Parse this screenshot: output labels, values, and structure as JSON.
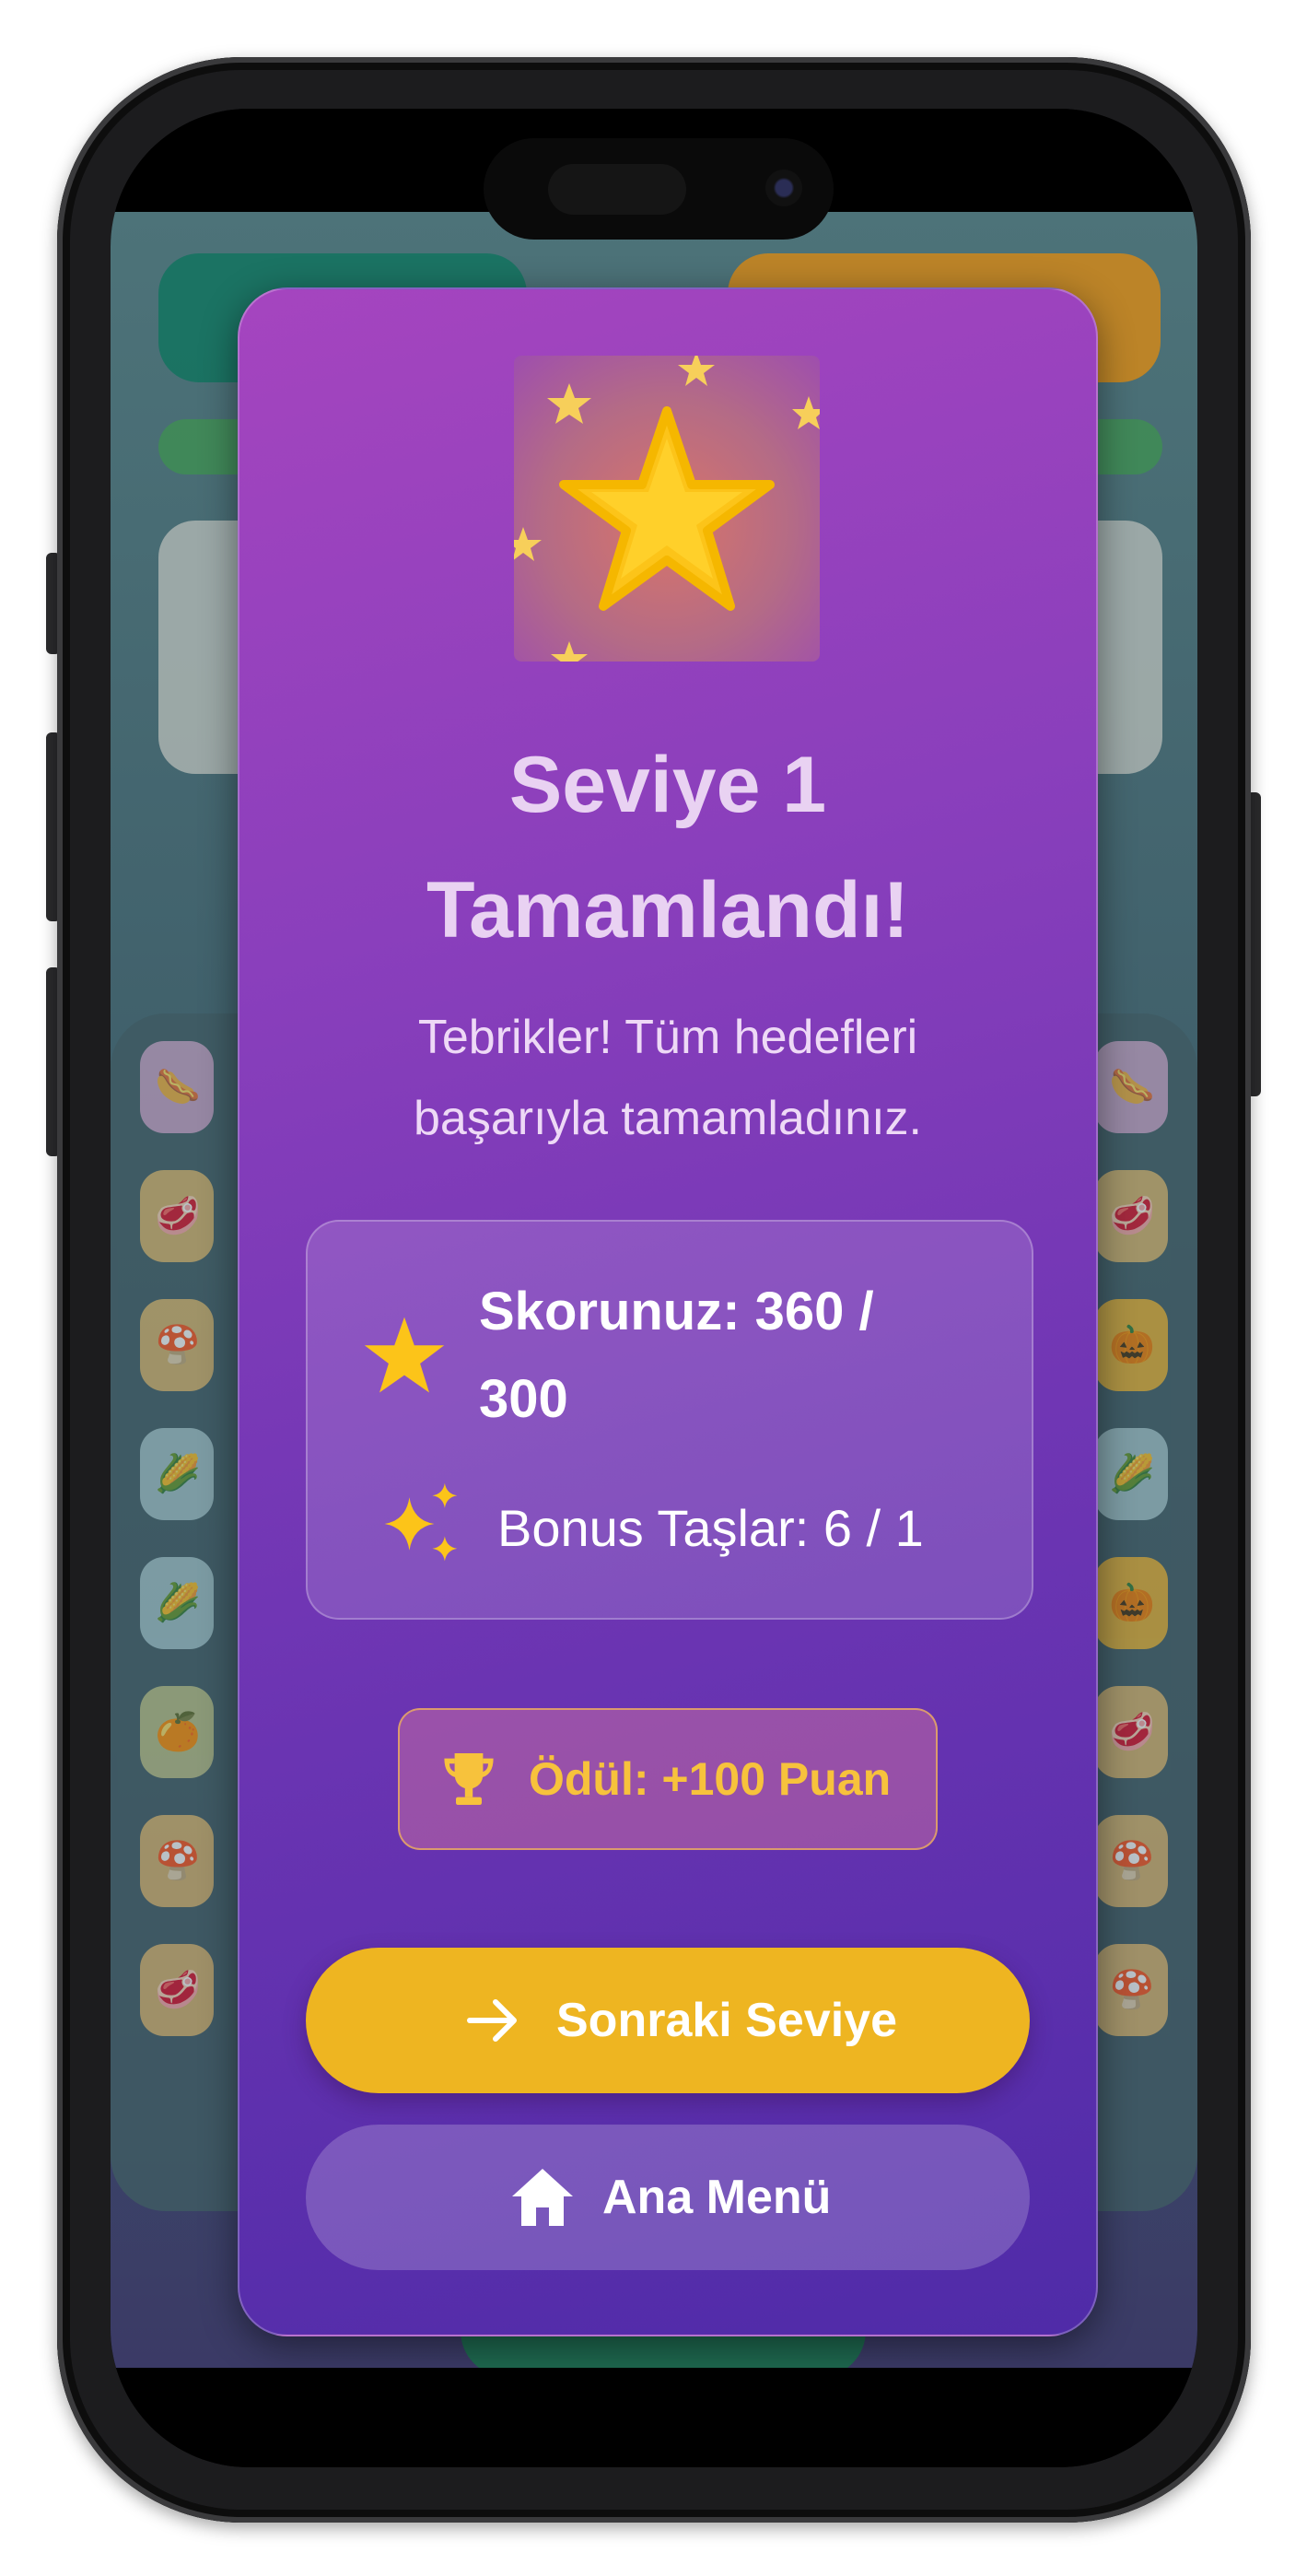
{
  "dialog": {
    "title_line1": "Seviye 1",
    "title_line2": "Tamamlandı!",
    "subtitle_line1": "Tebrikler! Tüm hedefleri",
    "subtitle_line2": "başarıyla tamamladınız.",
    "score_line1": "Skorunuz: 360 /",
    "score_line2": "300",
    "bonus": "Bonus Taşlar: 6 / 1",
    "reward": "Ödül: +100 Puan",
    "next_button": "Sonraki Seviye",
    "menu_button": "Ana Menü"
  },
  "icons": {
    "badge": "star-icon",
    "score": "star-icon",
    "bonus": "sparkles-icon",
    "reward": "trophy-icon",
    "next": "arrow-right-icon",
    "menu": "home-icon"
  },
  "colors": {
    "dialog_top": "#a545bf",
    "dialog_bottom": "#4f2ba8",
    "accent_yellow": "#eeb521",
    "reward_text": "#f7c23c",
    "star": "#fcc419"
  }
}
